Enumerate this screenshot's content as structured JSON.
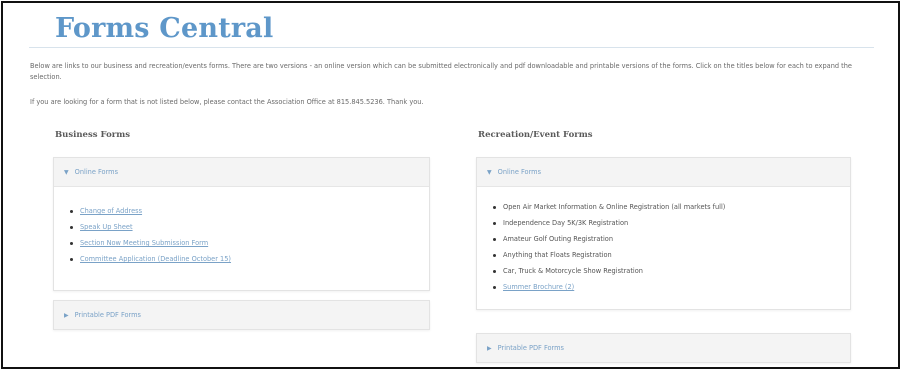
{
  "page": {
    "title": "Forms Central",
    "intro": "Below are links to our business and recreation/events forms. There are two versions - an online version which can be submitted electronically and pdf downloadable and printable versions of the forms. Click on the titles below for each to expand the selection.",
    "contact": "If you are looking for a form that is not listed below, please contact the Association Office at 815.845.5236. Thank you."
  },
  "business": {
    "heading": "Business Forms",
    "online": {
      "label": "Online Forms",
      "items": [
        "Change of Address",
        "Speak Up Sheet",
        "Section Now Meeting Submission Form",
        "Committee Application (Deadline October 15)"
      ]
    },
    "printable": {
      "label": "Printable PDF Forms"
    }
  },
  "recreation": {
    "heading": "Recreation/Event Forms",
    "online": {
      "label": "Online Forms",
      "items": [
        "Open Air Market Information & Online Registration (all markets full)",
        "Independence Day 5K/3K Registration",
        "Amateur Golf Outing Registration",
        "Anything that Floats Registration",
        "Car, Truck & Motorcycle Show Registration",
        "Summer Brochure (2)"
      ]
    },
    "printable": {
      "label": "Printable PDF Forms"
    }
  },
  "colors": {
    "accent": "#5e97c9",
    "link": "#7aa2c7"
  },
  "icons": {
    "expanded": "caret-down-icon",
    "collapsed": "caret-right-icon"
  }
}
